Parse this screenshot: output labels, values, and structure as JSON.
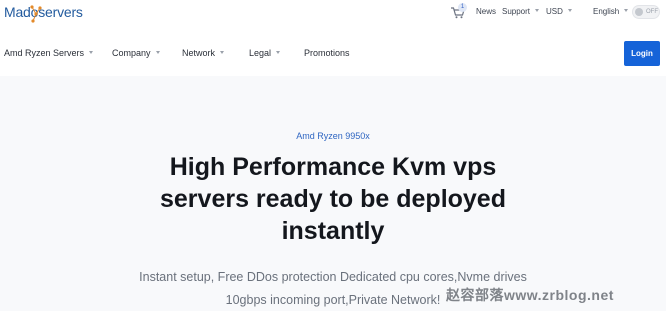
{
  "brand": {
    "name_part1": "Mado",
    "name_part2": "servers"
  },
  "utility": {
    "cart_count": "1",
    "news": "News",
    "support": "Support",
    "currency": "USD",
    "language": "English",
    "toggle_label": "OFF"
  },
  "nav": {
    "items": [
      {
        "label": "Amd Ryzen Servers",
        "dropdown": true
      },
      {
        "label": "Company",
        "dropdown": true
      },
      {
        "label": "Network",
        "dropdown": true
      },
      {
        "label": "Legal",
        "dropdown": true
      },
      {
        "label": "Promotions",
        "dropdown": false
      }
    ],
    "login": "Login"
  },
  "hero": {
    "eyebrow": "Amd Ryzen 9950x",
    "headline_line1": "High Performance Kvm vps",
    "headline_line2": "servers ready to be deployed",
    "headline_line3": "instantly",
    "sub_line1": "Instant setup, Free DDos protection Dedicated cpu cores,Nvme drives",
    "sub_line2": "10gbps incoming port,Private Network!"
  },
  "watermark": "赵容部落www.zrblog.net",
  "colors": {
    "accent": "#1563d8",
    "eyebrow": "#2f66c2",
    "background": "#f8f9fb"
  }
}
